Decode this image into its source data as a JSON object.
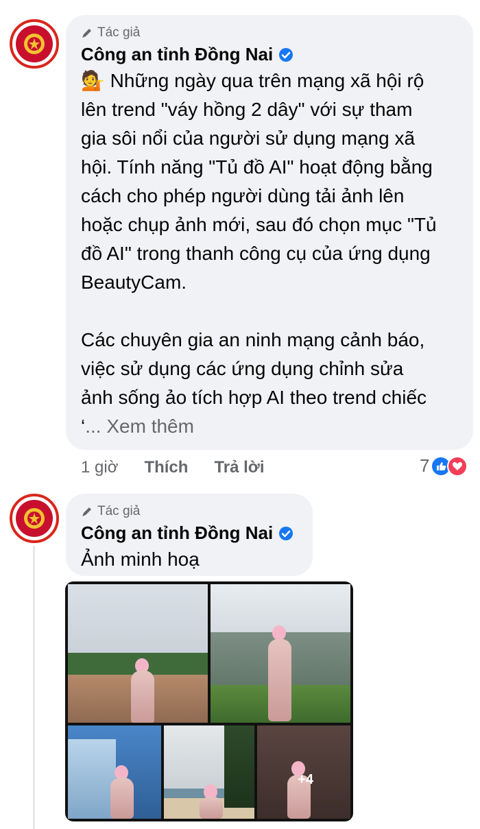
{
  "comments": [
    {
      "badge_label": "Tác giả",
      "author": "Công an tỉnh Đồng Nai",
      "emoji": "💁",
      "paragraph1": "Những ngày qua trên mạng xã hội rộ\nlên trend \"váy hồng 2 dây\" với sự tham\ngia sôi nổi của người sử dụng mạng xã\nhội. Tính năng \"Tủ đồ AI\" hoạt động bằng\ncách cho phép người dùng tải ảnh lên\nhoặc chụp ảnh mới, sau đó chọn mục \"Tủ\nđồ AI\" trong thanh công cụ của ứng dụng\nBeautyCam.",
      "paragraph2": "Các chuyên gia an ninh mạng cảnh báo,\nviệc sử dụng các ứng dụng chỉnh sửa\nảnh sống ảo tích hợp AI theo trend chiếc\n‘",
      "see_more": "... Xem thêm",
      "time": "1 giờ",
      "like_label": "Thích",
      "reply_label": "Trả lời",
      "reaction_count": "7",
      "reaction_icons": [
        "like-icon",
        "heart-icon"
      ]
    },
    {
      "badge_label": "Tác giả",
      "author": "Công an tỉnh Đồng Nai",
      "text": "Ảnh minh hoạ",
      "more_photos": "+4"
    }
  ],
  "colors": {
    "bubble": "#f0f2f5",
    "secondary_text": "#65676b",
    "verified": "#1877f2",
    "like": "#1877f2",
    "love": "#f33e58"
  }
}
